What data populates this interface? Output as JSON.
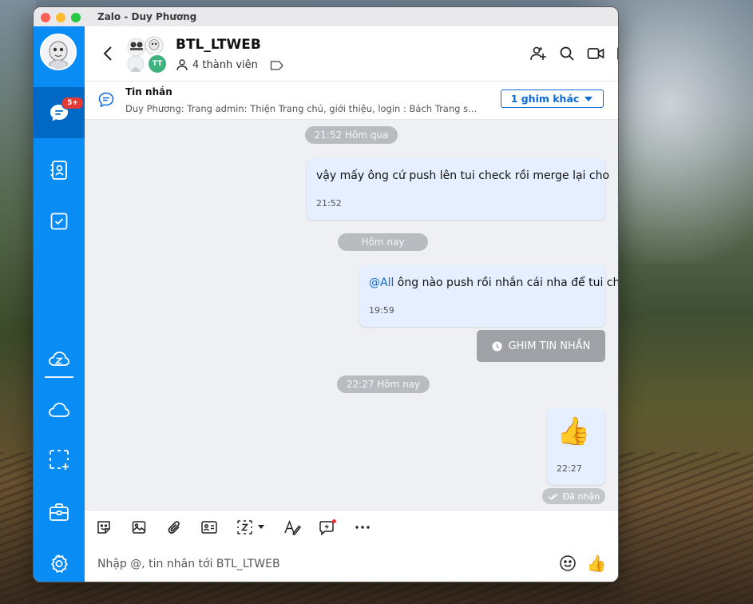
{
  "window": {
    "title": "Zalo - Duy Phương"
  },
  "sidebar": {
    "unread_badge": "5+"
  },
  "header": {
    "group_name": "BTL_LTWEB",
    "member_count": "4 thành viên",
    "avatar_initials": "TT"
  },
  "pinned": {
    "title": "Tin nhắn",
    "text": "Duy Phương: Trang admin: Thiện Trang chủ, giới thiệu, login : Bách Trang sản p...",
    "more_label": "1 ghim khác"
  },
  "messages": {
    "chip1": "21:52 Hôm qua",
    "msg1_text": "vậy mấy ông cứ push lên tui check rồi merge lại cho",
    "msg1_time": "21:52",
    "chip2": "Hôm nay",
    "msg2_mention": "@All",
    "msg2_text": " ông nào push rồi nhắn cái nha để tui check",
    "msg2_time": "19:59",
    "pin_button": "GHIM TIN NHẮN",
    "chip3": "22:27 Hôm nay",
    "msg3_emoji": "👍",
    "msg3_time": "22:27",
    "status": "Đã nhận"
  },
  "input": {
    "placeholder": "Nhập @, tin nhắn tới BTL_LTWEB",
    "value": ""
  },
  "colors": {
    "sidebar": "#0a8cf5",
    "sidebar_active": "#0069c6",
    "accent": "#0a68d8",
    "bubble": "#e6efff",
    "badge": "#e53935"
  },
  "icons": {
    "sidebar": [
      "chat-icon",
      "contacts-icon",
      "todo-icon",
      "zcloud-icon",
      "cloud-icon",
      "screenshot-icon",
      "toolbox-icon",
      "settings-icon"
    ],
    "header": [
      "back-icon",
      "add-member-icon",
      "search-icon",
      "video-call-icon",
      "side-panel-icon"
    ],
    "toolbar": [
      "sticker-icon",
      "image-icon",
      "attach-icon",
      "contact-card-icon",
      "capture-icon",
      "format-text-icon",
      "quick-message-icon",
      "more-icon"
    ],
    "input": [
      "emoji-icon",
      "thumbs-up-icon"
    ]
  }
}
